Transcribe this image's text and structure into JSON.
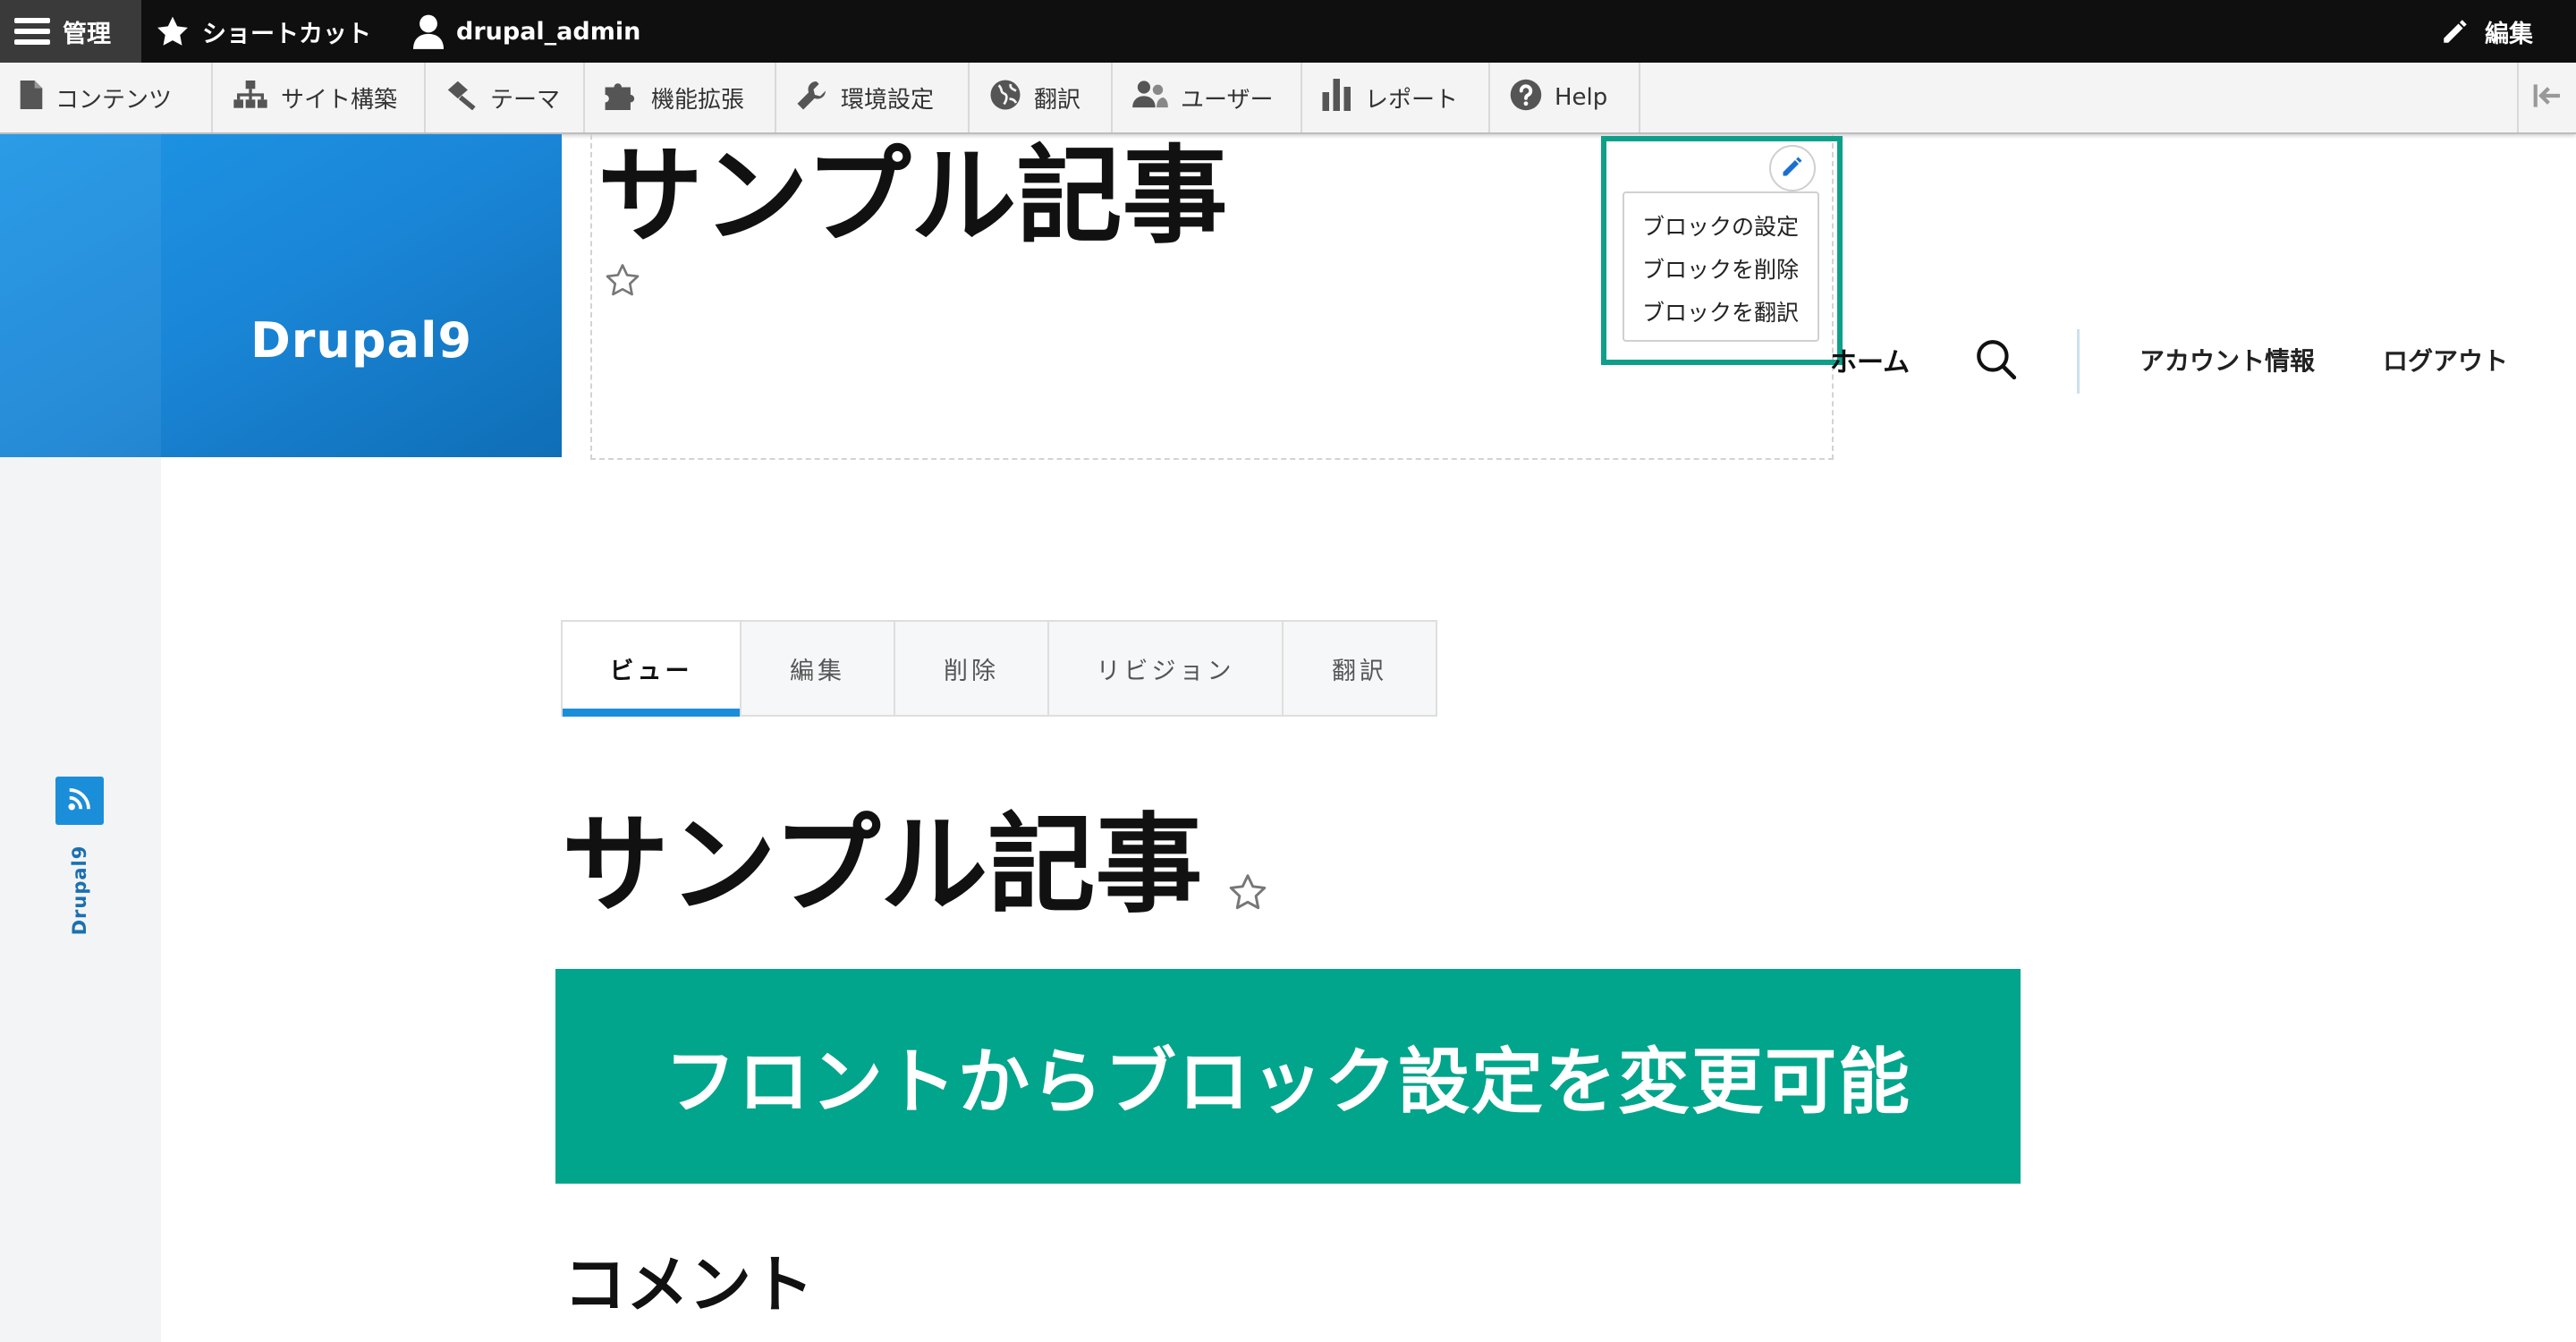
{
  "toolbar": {
    "menu_label": "管理",
    "shortcuts_label": "ショートカット",
    "user_label": "drupal_admin",
    "edit_label": "編集"
  },
  "tray": {
    "items": [
      {
        "label": "コンテンツ",
        "icon": "file-icon"
      },
      {
        "label": "サイト構築",
        "icon": "sitemap-icon"
      },
      {
        "label": "テーマ",
        "icon": "paint-roller-icon"
      },
      {
        "label": "機能拡張",
        "icon": "puzzle-icon"
      },
      {
        "label": "環境設定",
        "icon": "wrench-icon"
      },
      {
        "label": "翻訳",
        "icon": "globe-icon"
      },
      {
        "label": "ユーザー",
        "icon": "people-icon"
      },
      {
        "label": "レポート",
        "icon": "bar-chart-icon"
      },
      {
        "label": "Help",
        "icon": "help-icon"
      }
    ]
  },
  "site": {
    "name": "Drupal9",
    "sidebar_name": "Drupal9"
  },
  "title_block": {
    "title": "サンプル記事"
  },
  "contextual": {
    "items": [
      "ブロックの設定",
      "ブロックを削除",
      "ブロックを翻訳"
    ]
  },
  "nav": {
    "home": "ホーム",
    "account": "アカウント情報",
    "logout": "ログアウト"
  },
  "tabs": {
    "items": [
      "ビュー",
      "編集",
      "削除",
      "リビジョン",
      "翻訳"
    ],
    "active": "ビュー"
  },
  "content": {
    "title": "サンプル記事",
    "banner": "フロントからブロック設定を変更可能",
    "comments_title": "コメント"
  },
  "colors": {
    "brand_blue": "#1b8ed9",
    "accent_green": "#00a58b",
    "highlight_border": "#0e9f8a",
    "toolbar_black": "#0f0f0f"
  }
}
